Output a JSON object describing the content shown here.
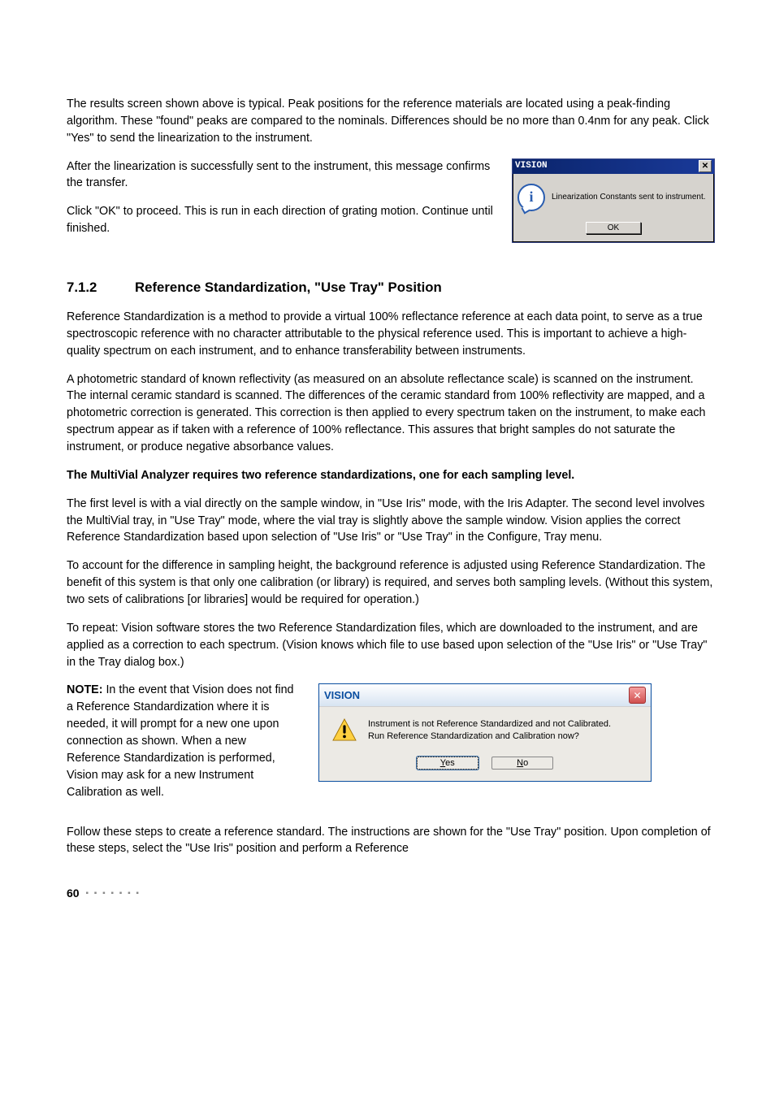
{
  "paragraphs": {
    "p1": "The results screen shown above is typical. Peak positions for the reference materials are located using a peak-finding algorithm. These \"found\" peaks are compared to the nominals. Differences should be no more than 0.4nm for any peak. Click \"Yes\" to send the linearization to the instrument.",
    "p2": "After the linearization is successfully sent to the instrument, this message confirms the transfer.",
    "p3": "Click \"OK\" to proceed. This is run in each direction of grating motion. Continue until finished.",
    "p4": "Reference Standardization is a method to provide a virtual 100% reflectance reference at each data point, to serve as a true spectroscopic reference with no character attributable to the physical reference used. This is important to achieve a high-quality spectrum on each instrument, and to enhance transferability between instruments.",
    "p5": "A photometric standard of known reflectivity (as measured on an absolute reflectance scale) is scanned on the instrument. The internal ceramic standard is scanned. The differences of the ceramic standard from 100% reflectivity are mapped, and a photometric correction is generated. This correction is then applied to every spectrum taken on the instrument, to make each spectrum appear as if taken with a reference of 100% reflectance. This assures that bright samples do not saturate the instrument, or produce negative absorbance values.",
    "p6": "The MultiVial Analyzer requires two reference standardizations, one for each sampling level.",
    "p7": "The first level is with a vial directly on the sample window, in \"Use Iris\" mode, with the Iris Adapter. The second level involves the MultiVial tray, in \"Use Tray\" mode, where the vial tray is slightly above the sample window. Vision applies the correct Reference Standardization based upon selection of \"Use Iris\" or \"Use Tray\" in the Configure, Tray menu.",
    "p8": "To account for the difference in sampling height, the background reference is adjusted using Reference Standardization. The benefit of this system is that only one calibration (or library) is required, and serves both sampling levels. (Without this system, two sets of calibrations [or libraries] would be required for operation.)",
    "p9": "To repeat: Vision software stores the two Reference Standardization files, which are downloaded to the instrument, and are applied as a correction to each spectrum. (Vision knows which file to use based upon selection of the \"Use Iris\" or \"Use Tray\" in the Tray dialog box.)",
    "p10_note": "NOTE:",
    "p10_body": " In the event that Vision does not find a Reference Standardization where it is needed, it will prompt for a new one upon connection as shown. When a new Reference Standardization is performed, Vision may ask for a new Instrument Calibration as well.",
    "p11": "Follow these steps to create a reference standard. The instructions are shown for the \"Use Tray\" position. Upon completion of these steps, select the \"Use Iris\" position and perform a Reference"
  },
  "heading": {
    "number": "7.1.2",
    "title": "Reference Standardization, \"Use Tray\" Position"
  },
  "dialog1": {
    "title": "VISION",
    "message": "Linearization Constants sent to instrument.",
    "ok": "OK"
  },
  "dialog2": {
    "title": "VISION",
    "message_line1": "Instrument is not Reference Standardized and not Calibrated.",
    "message_line2": "Run Reference Standardization and Calibration now?",
    "yes_u": "Y",
    "yes_rest": "es",
    "no_u": "N",
    "no_rest": "o"
  },
  "footer": {
    "page": "60",
    "dots": "▪ ▪ ▪ ▪ ▪ ▪ ▪"
  }
}
